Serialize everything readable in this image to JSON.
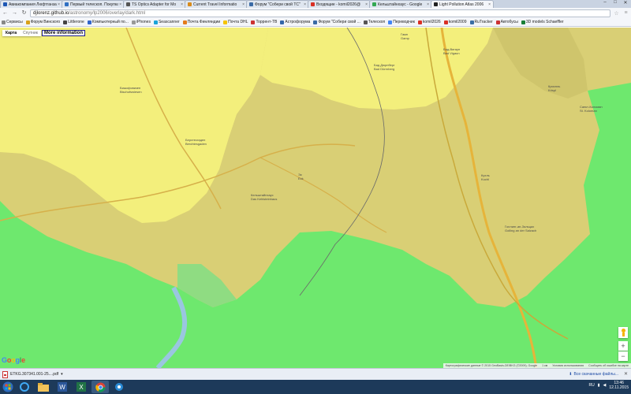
{
  "browser": {
    "tabs": [
      {
        "title": "Авиакомпания Люфтганза",
        "color": "#1d57b4",
        "active": false
      },
      {
        "title": "Первый телескоп. Покупка",
        "color": "#2f6fc2",
        "active": false
      },
      {
        "title": "TS Optics Adapter for Mo",
        "color": "#555555",
        "active": false
      },
      {
        "title": "Current Travel Informatio",
        "color": "#d88b1b",
        "active": false
      },
      {
        "title": "Форум \"Собери свой ТС\"",
        "color": "#3a6aa5",
        "active": false
      },
      {
        "title": "Входящие - komil2026@",
        "color": "#d93025",
        "active": false
      },
      {
        "title": "Кельштайнхаус - Google",
        "color": "#34a853",
        "active": false
      },
      {
        "title": "Light Pollution Atlas 2006",
        "color": "#222222",
        "active": true
      }
    ],
    "url_host": "djlorenz.github.io",
    "url_path": "/astronomy/lp2006/overlay/dark.html",
    "bookmarks": [
      {
        "label": "Сервисы",
        "color": "#888888"
      },
      {
        "label": "Форум Винского",
        "color": "#d9a11b"
      },
      {
        "label": "Littlerone",
        "color": "#444444"
      },
      {
        "label": "Компьютерный по...",
        "color": "#3366cc"
      },
      {
        "label": "iPhones",
        "color": "#999999"
      },
      {
        "label": "Seascanner",
        "color": "#1aa4d8"
      },
      {
        "label": "Почта Финляндии",
        "color": "#e37b1c"
      },
      {
        "label": "Почта DHL",
        "color": "#f5c400"
      },
      {
        "label": "Торрент-ТВ",
        "color": "#cc3333"
      },
      {
        "label": "Астрофорума",
        "color": "#3366aa"
      },
      {
        "label": "Форум \"Собери свой ...",
        "color": "#3a6aa5"
      },
      {
        "label": "Телескоп",
        "color": "#555555"
      },
      {
        "label": "Переводчик",
        "color": "#4285f4"
      },
      {
        "label": "komil2026",
        "color": "#d93025"
      },
      {
        "label": "komil2009",
        "color": "#d93025"
      },
      {
        "label": "RuTracker",
        "color": "#3b6ea5"
      },
      {
        "label": "Автобусы",
        "color": "#cc3333"
      },
      {
        "label": "3D models Schaeffler",
        "color": "#1a7f37"
      }
    ]
  },
  "map": {
    "maptype": {
      "map": "Карта",
      "satellite": "Спутник"
    },
    "more_info": "More information",
    "labels": [
      {
        "id": "bischofswiesen",
        "line1": "Бишофсвизен",
        "line2": "Bischofswiesen"
      },
      {
        "id": "berchtesgaden",
        "line1": "Берхтесгаден",
        "line2": "Berchtesgaden"
      },
      {
        "id": "bad-duerrnberg",
        "line1": "Бад Дюрнберг",
        "line2": "Bad Dürrnberg"
      },
      {
        "id": "bad-vigaun",
        "line1": "Бад-Вигаун",
        "line2": "Bad Vigaun"
      },
      {
        "id": "kellsteinhaus",
        "line1": "Кельштайнхаус",
        "line2": "Das Kehlsteinhaus"
      },
      {
        "id": "kuchl",
        "line1": "Кухль",
        "line2": "Kuchl"
      },
      {
        "id": "krispl",
        "line1": "Криспль",
        "line2": "Krispl"
      },
      {
        "id": "st-koloman",
        "line1": "Санкт-Коломан",
        "line2": "St. Koloman"
      },
      {
        "id": "golling",
        "line1": "Голлинг-ан-Зальцах",
        "line2": "Golling an der Salzach"
      },
      {
        "id": "eck",
        "line1": "Эк",
        "line2": "Eck"
      },
      {
        "id": "gamp",
        "line1": "Гамп",
        "line2": "Gamp"
      }
    ],
    "google": [
      "G",
      "o",
      "o",
      "g",
      "l",
      "e"
    ],
    "google_colors": [
      "#4285f4",
      "#ea4335",
      "#fbbc05",
      "#4285f4",
      "#34a853",
      "#ea4335"
    ],
    "attribution": {
      "data": "Картографические данные © 2015 GeoBasis-DE/BKG (©2009), Google",
      "scale": "1 км",
      "terms": "Условия использования",
      "report": "Сообщить об ошибке на карте"
    },
    "colors": {
      "green": "#6ee86e",
      "yellow": "#f3ef7c",
      "olive": "#d9cf75",
      "road": "#e6b43a"
    }
  },
  "downloads": {
    "file": "ETKG.307341.001-25....pdf",
    "show_all": "Все скачанные файлы..."
  },
  "taskbar": {
    "language": "RU",
    "time": "13:46",
    "date": "12.11.2015"
  }
}
